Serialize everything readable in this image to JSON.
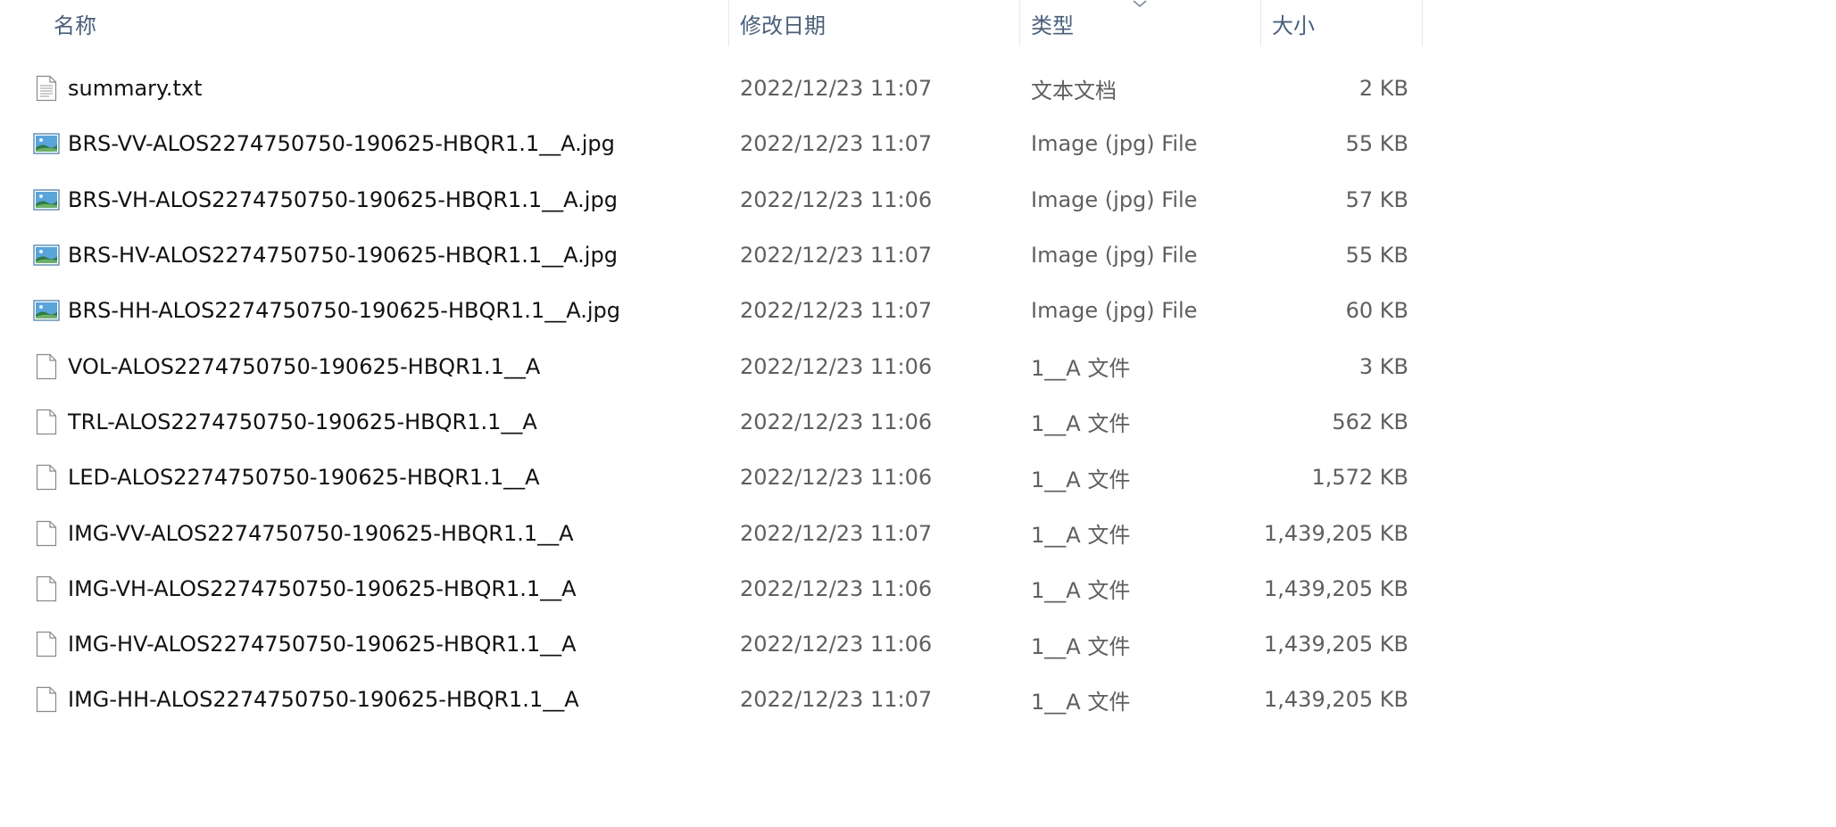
{
  "header": {
    "name": "名称",
    "date": "修改日期",
    "type": "类型",
    "size": "大小",
    "sort_icon": "chevron-down-icon"
  },
  "files": [
    {
      "name": "summary.txt",
      "date": "2022/12/23 11:07",
      "type": "文本文档",
      "size": "2 KB",
      "icon": "text-file-icon"
    },
    {
      "name": "BRS-VV-ALOS2274750750-190625-HBQR1.1__A.jpg",
      "date": "2022/12/23 11:07",
      "type": "Image (jpg) File",
      "size": "55 KB",
      "icon": "image-file-icon"
    },
    {
      "name": "BRS-VH-ALOS2274750750-190625-HBQR1.1__A.jpg",
      "date": "2022/12/23 11:06",
      "type": "Image (jpg) File",
      "size": "57 KB",
      "icon": "image-file-icon"
    },
    {
      "name": "BRS-HV-ALOS2274750750-190625-HBQR1.1__A.jpg",
      "date": "2022/12/23 11:07",
      "type": "Image (jpg) File",
      "size": "55 KB",
      "icon": "image-file-icon"
    },
    {
      "name": "BRS-HH-ALOS2274750750-190625-HBQR1.1__A.jpg",
      "date": "2022/12/23 11:07",
      "type": "Image (jpg) File",
      "size": "60 KB",
      "icon": "image-file-icon"
    },
    {
      "name": "VOL-ALOS2274750750-190625-HBQR1.1__A",
      "date": "2022/12/23 11:06",
      "type": "1__A 文件",
      "size": "3 KB",
      "icon": "blank-file-icon"
    },
    {
      "name": "TRL-ALOS2274750750-190625-HBQR1.1__A",
      "date": "2022/12/23 11:06",
      "type": "1__A 文件",
      "size": "562 KB",
      "icon": "blank-file-icon"
    },
    {
      "name": "LED-ALOS2274750750-190625-HBQR1.1__A",
      "date": "2022/12/23 11:06",
      "type": "1__A 文件",
      "size": "1,572 KB",
      "icon": "blank-file-icon"
    },
    {
      "name": "IMG-VV-ALOS2274750750-190625-HBQR1.1__A",
      "date": "2022/12/23 11:07",
      "type": "1__A 文件",
      "size": "1,439,205 KB",
      "icon": "blank-file-icon"
    },
    {
      "name": "IMG-VH-ALOS2274750750-190625-HBQR1.1__A",
      "date": "2022/12/23 11:06",
      "type": "1__A 文件",
      "size": "1,439,205 KB",
      "icon": "blank-file-icon"
    },
    {
      "name": "IMG-HV-ALOS2274750750-190625-HBQR1.1__A",
      "date": "2022/12/23 11:06",
      "type": "1__A 文件",
      "size": "1,439,205 KB",
      "icon": "blank-file-icon"
    },
    {
      "name": "IMG-HH-ALOS2274750750-190625-HBQR1.1__A",
      "date": "2022/12/23 11:07",
      "type": "1__A 文件",
      "size": "1,439,205 KB",
      "icon": "blank-file-icon"
    }
  ],
  "colors": {
    "header_text": "#4a5f7a",
    "name_text": "#111111",
    "meta_text": "#5f5f5f",
    "column_divider": "#e8e8e8"
  }
}
